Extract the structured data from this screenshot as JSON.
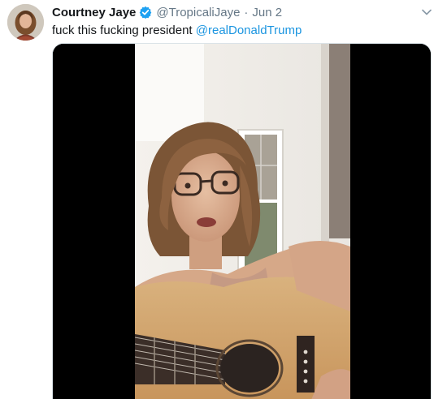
{
  "tweet": {
    "author": {
      "display_name": "Courtney Jaye",
      "handle": "@TropicaliJaye",
      "verified": true
    },
    "separator": "·",
    "date": "Jun 2",
    "text": "fuck this fucking president",
    "mention": "@realDonaldTrump",
    "icons": {
      "verified": "verified-badge-icon",
      "menu": "chevron-down-icon"
    },
    "colors": {
      "link": "#1b95e0",
      "verified": "#1da1f2",
      "secondary_text": "#657786"
    }
  }
}
